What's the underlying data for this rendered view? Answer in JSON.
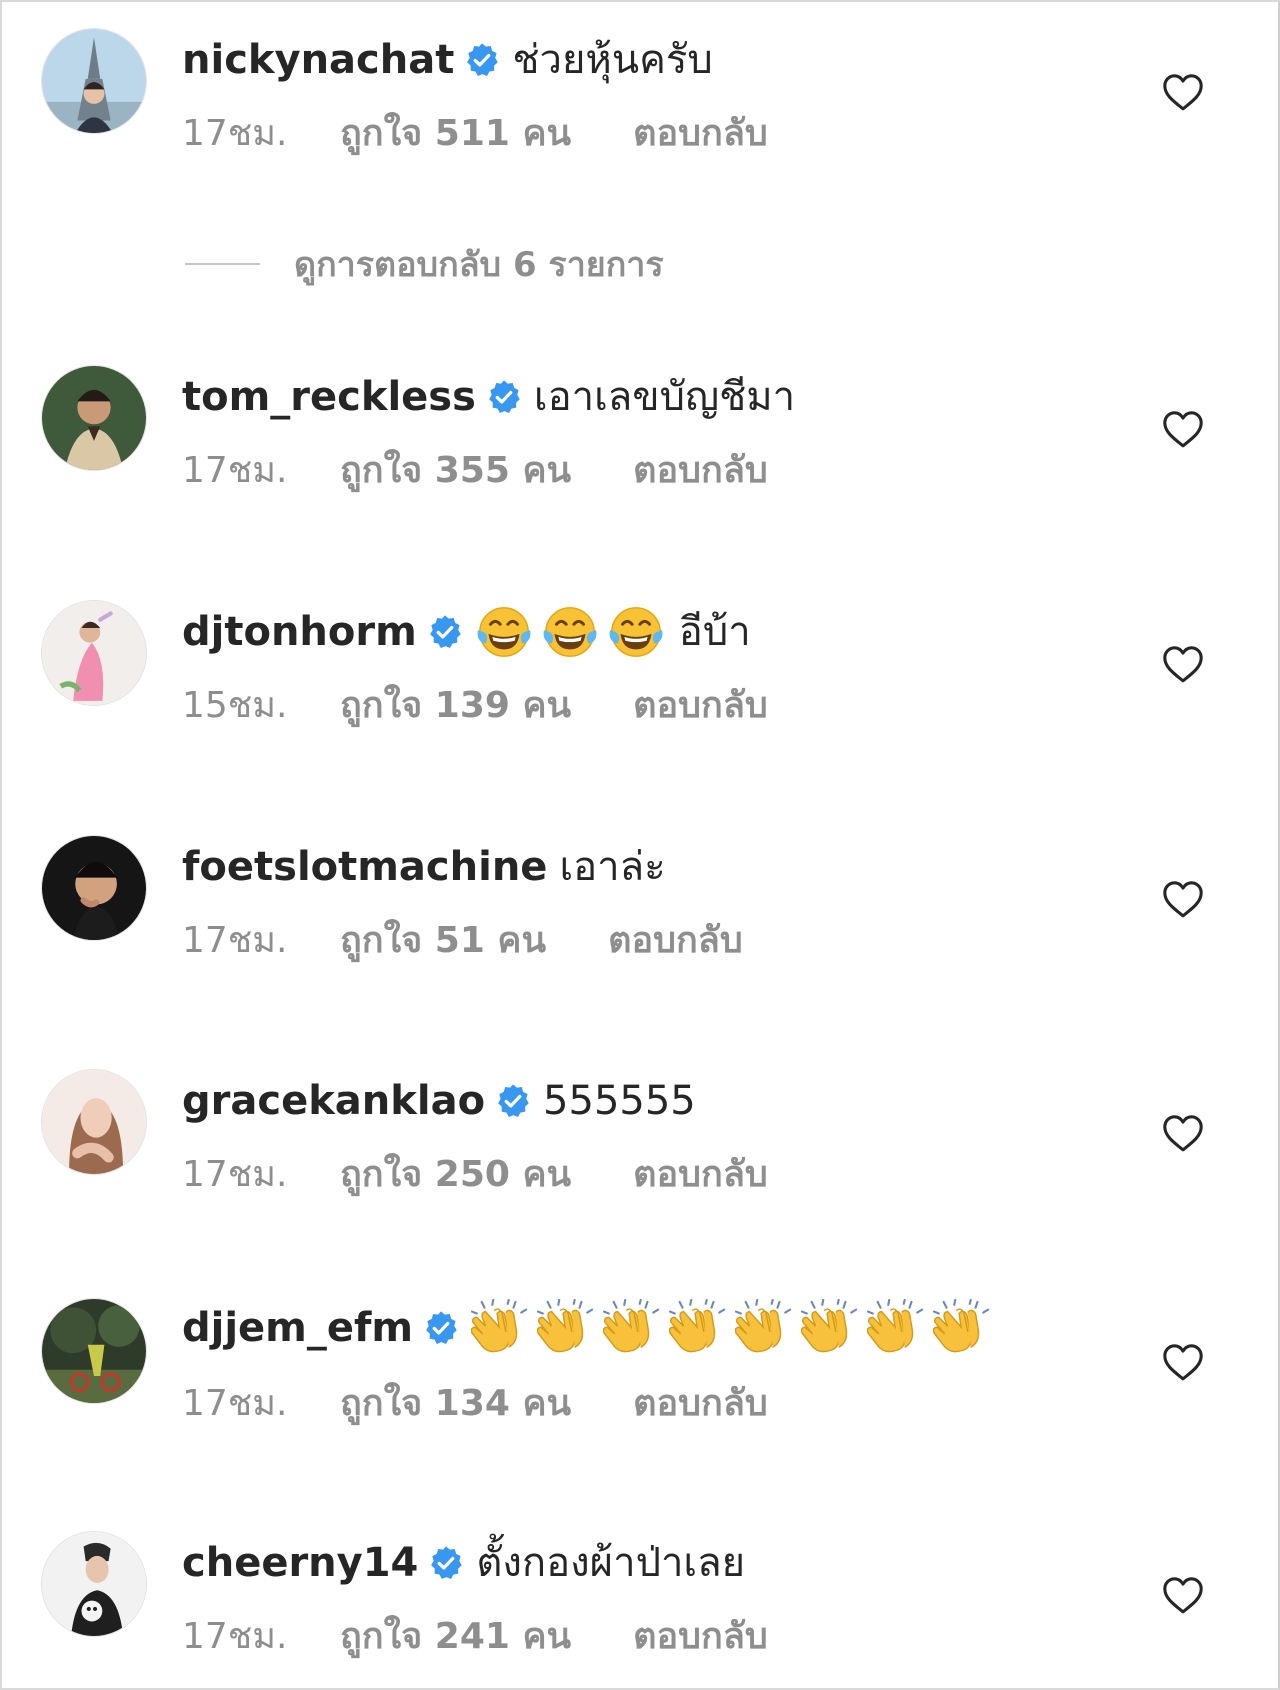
{
  "colors": {
    "verified_blue": "#3897f0",
    "meta_gray": "#8e8e8e",
    "text": "#262626"
  },
  "view_replies": {
    "label": "ดูการตอบกลับ 6 รายการ"
  },
  "comments": [
    {
      "username": "nickynachat",
      "verified": true,
      "text": "ช่วยหุ้นครับ",
      "time": "17ชม.",
      "likes": "ถูกใจ 511 คน",
      "reply": "ตอบกลับ"
    },
    {
      "username": "tom_reckless",
      "verified": true,
      "text": "เอาเลขบัญชีมา",
      "time": "17ชม.",
      "likes": "ถูกใจ 355 คน",
      "reply": "ตอบกลับ"
    },
    {
      "username": "djtonhorm",
      "verified": true,
      "text": "อีบ้า",
      "emoji": "tears-of-joy-emoji",
      "emoji_count": 3,
      "time": "15ชม.",
      "likes": "ถูกใจ 139 คน",
      "reply": "ตอบกลับ"
    },
    {
      "username": "foetslotmachine",
      "verified": false,
      "text": "เอาล่ะ",
      "time": "17ชม.",
      "likes": "ถูกใจ 51 คน",
      "reply": "ตอบกลับ"
    },
    {
      "username": "gracekanklao",
      "verified": true,
      "text": "555555",
      "time": "17ชม.",
      "likes": "ถูกใจ 250 คน",
      "reply": "ตอบกลับ"
    },
    {
      "username": "djjem_efm",
      "verified": true,
      "text": "",
      "emoji": "clapping-hands-emoji",
      "emoji_count": 8,
      "time": "17ชม.",
      "likes": "ถูกใจ 134 คน",
      "reply": "ตอบกลับ"
    },
    {
      "username": "cheerny14",
      "verified": true,
      "text": "ตั้งกองผ้าป่าเลย",
      "time": "17ชม.",
      "likes": "ถูกใจ 241 คน",
      "reply": "ตอบกลับ"
    }
  ]
}
